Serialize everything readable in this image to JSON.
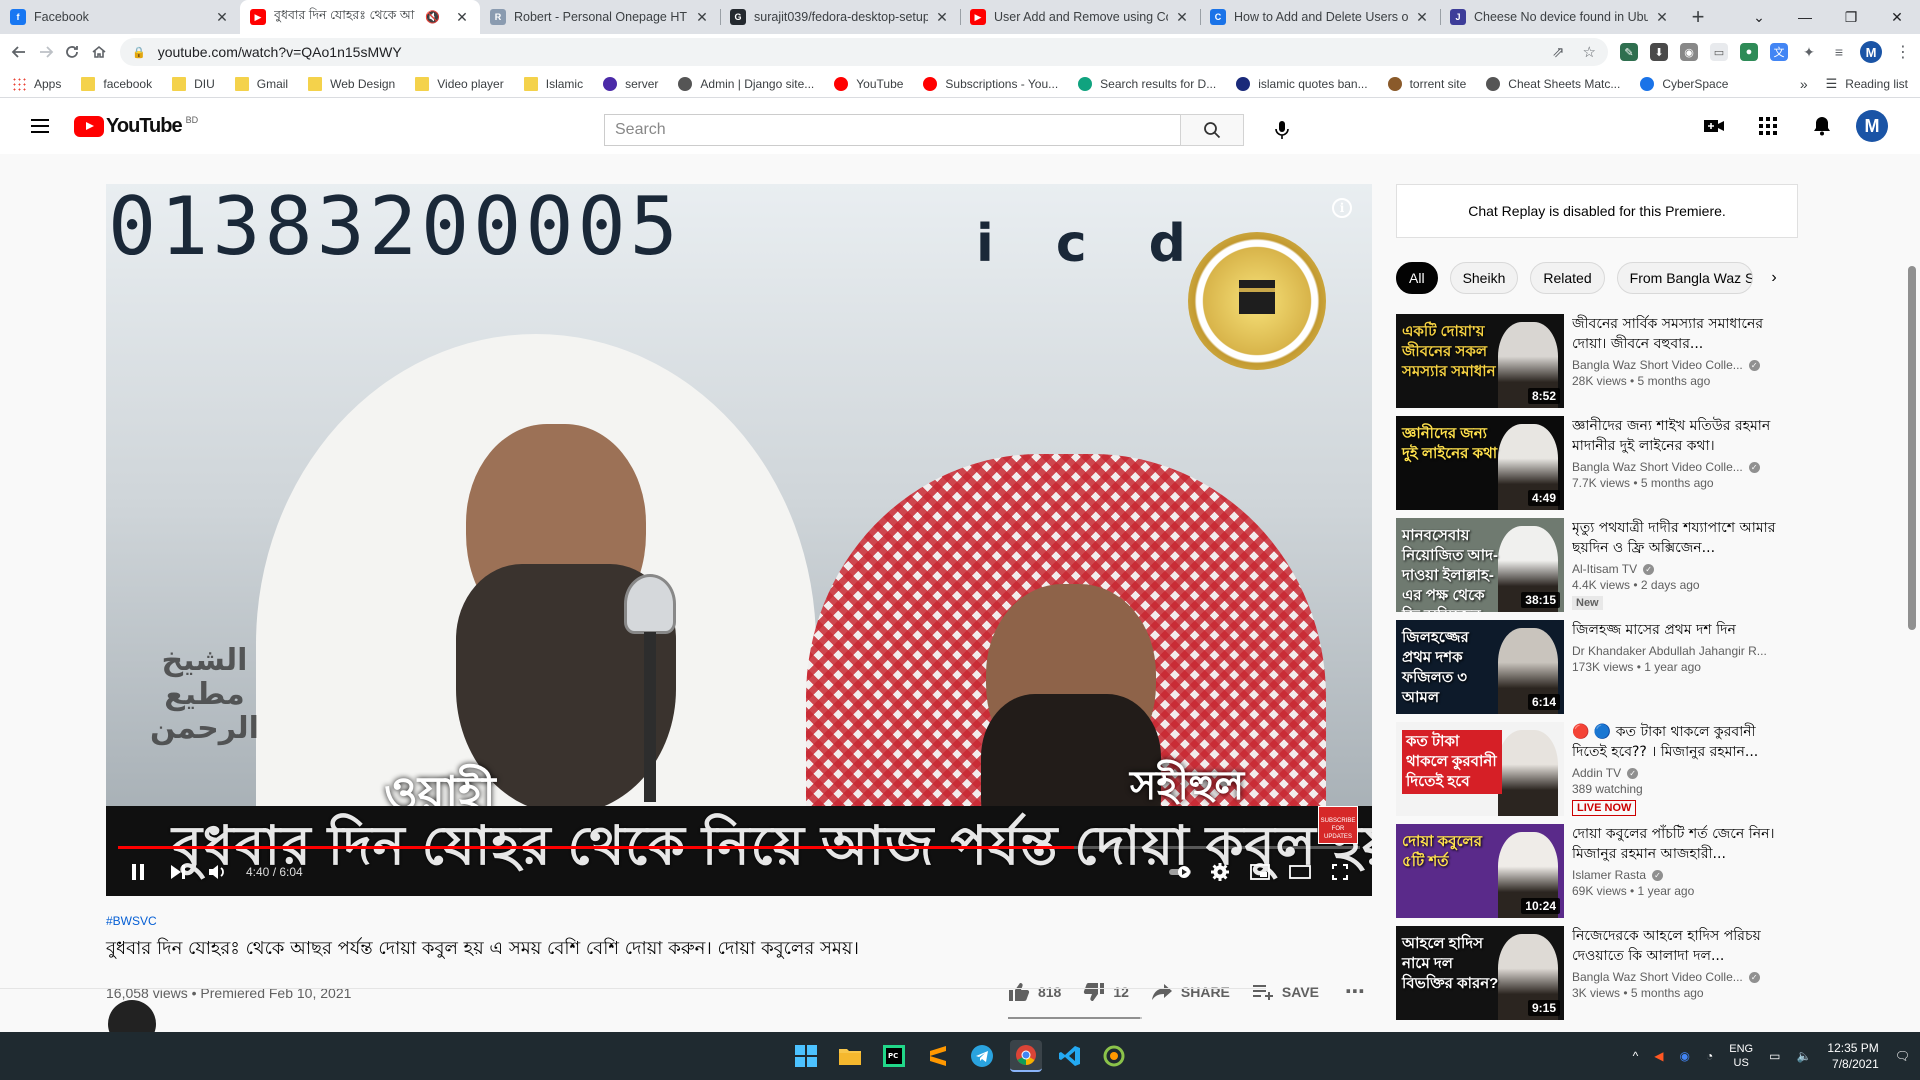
{
  "browser": {
    "tabs": [
      {
        "title": "Facebook",
        "favicon_color": "#1877f2",
        "favicon_glyph": "f",
        "active": false
      },
      {
        "title": "বুধবার দিন যোহরঃ থেকে আ",
        "favicon_color": "#ff0000",
        "favicon_glyph": "▶",
        "active": true,
        "muted_glyph": "🔇"
      },
      {
        "title": "Robert - Personal Onepage HTM",
        "favicon_color": "#8a9bb0",
        "favicon_glyph": "R",
        "active": false
      },
      {
        "title": "surajit039/fedora-desktop-setup",
        "favicon_color": "#24292f",
        "favicon_glyph": "G",
        "active": false
      },
      {
        "title": "User Add and Remove using Co",
        "favicon_color": "#ff0000",
        "favicon_glyph": "▶",
        "active": false
      },
      {
        "title": "How to Add and Delete Users o",
        "favicon_color": "#1a73e8",
        "favicon_glyph": "C",
        "active": false
      },
      {
        "title": "Cheese No device found in Ubu",
        "favicon_color": "#3d3d99",
        "favicon_glyph": "J",
        "active": false
      }
    ],
    "url": "youtube.com/watch?v=QAo1n15sMWY",
    "bookmarks": [
      {
        "label": "Apps",
        "type": "apps"
      },
      {
        "label": "facebook",
        "type": "folder"
      },
      {
        "label": "DIU",
        "type": "folder"
      },
      {
        "label": "Gmail",
        "type": "folder"
      },
      {
        "label": "Web Design",
        "type": "folder"
      },
      {
        "label": "Video player",
        "type": "folder"
      },
      {
        "label": "Islamic",
        "type": "folder"
      },
      {
        "label": "server",
        "type": "site",
        "color": "#4b2aa8"
      },
      {
        "label": "Admin | Django site...",
        "type": "site",
        "color": "#555555"
      },
      {
        "label": "YouTube",
        "type": "site",
        "color": "#ff0000"
      },
      {
        "label": "Subscriptions - You...",
        "type": "site",
        "color": "#ff0000"
      },
      {
        "label": "Search results for D...",
        "type": "site",
        "color": "#10a37f"
      },
      {
        "label": "islamic quotes ban...",
        "type": "site",
        "color": "#1a2a7a"
      },
      {
        "label": "torrent site",
        "type": "site",
        "color": "#8a5a2a"
      },
      {
        "label": "Cheat Sheets Matc...",
        "type": "site",
        "color": "#555555"
      },
      {
        "label": "CyberSpace",
        "type": "site",
        "color": "#1a73e8"
      }
    ],
    "bookmarks_more": "»",
    "reading_list": "Reading list",
    "profile_initial": "M"
  },
  "youtube": {
    "logo_text": "YouTube",
    "country_code": "BD",
    "search_placeholder": "Search",
    "avatar_initial": "M"
  },
  "player": {
    "overlay_phone": "01383200005",
    "overlay_letters": "icd",
    "arabic_name": "الشيخ\nمطيع\nالرحمن",
    "name_left": "ওয়াহী",
    "name_right": "সহীহুল",
    "caption": "বুধবার দিন যোহর থেকে নিয়ে আজ পর্যন্ত দোয়া কবুল হয়",
    "subscribe_badge": "SUBSCRIBE FOR UPDATES",
    "time": "4:40 / 6:04",
    "progress": 0.77
  },
  "video": {
    "hashtag": "#BWSVC",
    "title": "বুধবার দিন যোহরঃ থেকে আছর পর্যন্ত দোয়া কবুল হয় এ সময় বেশি বেশি দোয়া করুন। দোয়া কবুলের সময়।",
    "views": "16,058 views",
    "premiered": "Premiered Feb 10, 2021",
    "likes": "818",
    "dislikes": "12",
    "like_ratio": 0.985,
    "share_label": "SHARE",
    "save_label": "SAVE"
  },
  "sidebar": {
    "chat_replay": "Chat Replay is disabled for this Premiere.",
    "chips": [
      "All",
      "Sheikh",
      "Related",
      "From Bangla Waz S"
    ],
    "recommendations": [
      {
        "title": "জীবনের সার্বিক সমস্যার সমাধানের দোয়া। জীবনে বহুবার...",
        "channel": "Bangla Waz Short Video Colle...",
        "verified": true,
        "meta": "28K views • 5 months ago",
        "duration": "8:52",
        "thumb_text": "একটি দোয়া'য় জীবনের সকল সমস্যার সমাধান",
        "thumb_bg": "#101010",
        "thumb_text_color": "#f5d142",
        "person_color": "#d9d6d2"
      },
      {
        "title": "জ্ঞানীদের জন্য শাইখ মতিউর রহমান মাদানীর দুই লাইনের কথা।",
        "channel": "Bangla Waz Short Video Colle...",
        "verified": true,
        "meta": "7.7K views • 5 months ago",
        "duration": "4:49",
        "thumb_text": "জ্ঞানীদের জন্য দুই লাইনের কথা",
        "thumb_bg": "#0b0b0b",
        "thumb_text_color": "#ffe14d",
        "person_color": "#e8e6e2"
      },
      {
        "title": "মৃত্যু পথযাত্রী দাদীর শয্যাপাশে আমার ছয়দিন ও ফ্রি অক্সিজেন...",
        "channel": "Al-Itisam TV",
        "verified": true,
        "meta": "4.4K views • 2 days ago",
        "duration": "38:15",
        "badge": "New",
        "thumb_text": "মানবসেবায় নিয়োজিত আদ-দাওয়া ইলাল্লাহ-এর পক্ষ থেকে ফ্রি অক্সিজেন সেবা",
        "thumb_bg": "#6f7a70",
        "thumb_text_color": "#ffffff",
        "person_color": "#f0f0ee"
      },
      {
        "title": "জিলহজ্জ মাসের প্রথম দশ দিন",
        "channel": "Dr Khandaker Abdullah Jahangir R...",
        "verified": false,
        "meta": "173K views • 1 year ago",
        "duration": "6:14",
        "thumb_text": "জিলহজ্জের প্রথম দশক ফজিলত ৩ আমল",
        "thumb_bg": "#0d1a2a",
        "thumb_text_color": "#ffffff",
        "person_color": "#c9c4bd"
      },
      {
        "title": "🔴 🔵 কত টাকা থাকলে কুরবানী দিতেই হবে?? । মিজানুর রহমান...",
        "channel": "Addin TV",
        "verified": true,
        "meta": "389 watching",
        "duration": "",
        "badge_live": "LIVE NOW",
        "thumb_text": "কত টাকা থাকলে কুরবানী দিতেই হবে",
        "thumb_bg": "#f3f3f3",
        "thumb_text_color": "#ffffff",
        "person_color": "#e7e3de"
      },
      {
        "title": "দোয়া কবুলের পাঁচটি শর্ত জেনে নিন। মিজানুর রহমান আজহারী...",
        "channel": "Islamer Rasta",
        "verified": true,
        "meta": "69K views • 1 year ago",
        "duration": "10:24",
        "thumb_text": "দোয়া কবুলের ৫টি শর্ত",
        "thumb_bg": "#5a2a8a",
        "thumb_text_color": "#ffe14d",
        "person_color": "#efece8"
      },
      {
        "title": "নিজেদেরকে আহলে হাদিস পরিচয় দেওয়াতে কি আলাদা দল...",
        "channel": "Bangla Waz Short Video Colle...",
        "verified": true,
        "meta": "3K views • 5 months ago",
        "duration": "9:15",
        "thumb_text": "আহলে হাদিস নামে দল বিভক্তির কারন?",
        "thumb_bg": "#121212",
        "thumb_text_color": "#ffffff",
        "person_color": "#dedad5"
      }
    ]
  },
  "taskbar": {
    "lang_line1": "ENG",
    "lang_line2": "US",
    "time": "12:35 PM",
    "date": "7/8/2021"
  }
}
